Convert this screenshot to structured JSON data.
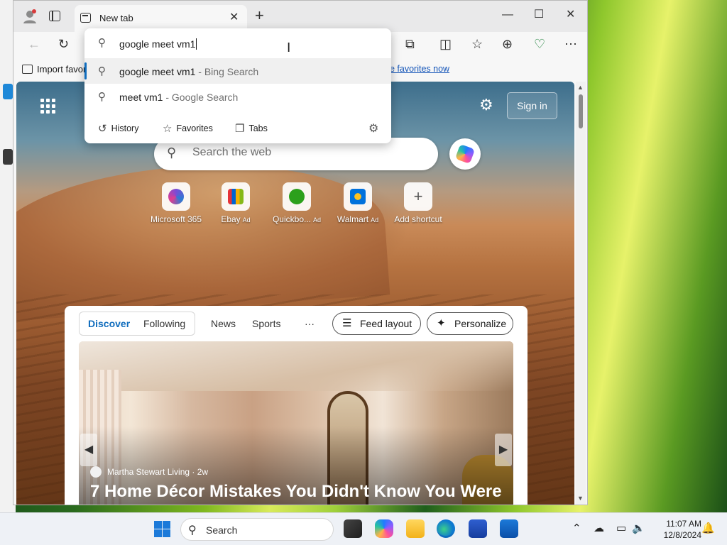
{
  "browser": {
    "tab_title": "New tab",
    "close_symbol": "✕",
    "new_tab_symbol": "+",
    "window_controls": {
      "minimize": "—",
      "maximize": "☐",
      "close": "✕"
    },
    "toolbar_icons": {
      "back": "←",
      "refresh": "↻",
      "extensions": "⧉",
      "split": "◫",
      "favorites": "☆",
      "collections": "⊕",
      "health": "♡",
      "more": "⋯"
    },
    "favorites_bar": {
      "import_label": "Import favor",
      "manage_link": "e favorites now"
    }
  },
  "omnibox": {
    "query": "google meet vm1",
    "suggestions": [
      {
        "text": "google meet vm1",
        "engine": " - Bing Search"
      },
      {
        "text": "meet vm1",
        "engine": " - Google Search"
      }
    ],
    "chips": [
      {
        "label": "History",
        "icon": "history-icon"
      },
      {
        "label": "Favorites",
        "icon": "star-icon"
      },
      {
        "label": "Tabs",
        "icon": "tabs-icon"
      }
    ]
  },
  "newtab": {
    "sign_in": "Sign in",
    "search_placeholder": "Search the web",
    "shortcuts": [
      {
        "label": "Microsoft 365",
        "ad": "",
        "color": "#7b4bd6"
      },
      {
        "label": "Ebay",
        "ad": "Ad",
        "color": "#e53238"
      },
      {
        "label": "Quickbo...",
        "ad": "Ad",
        "color": "#2ca01c"
      },
      {
        "label": "Walmart",
        "ad": "Ad",
        "color": "#0071dc"
      },
      {
        "label": "Add shortcut",
        "ad": "",
        "color": "#ffffff"
      }
    ],
    "feed": {
      "tabs": [
        "Discover",
        "Following",
        "News",
        "Sports",
        "···"
      ],
      "feed_layout": "Feed layout",
      "personalize": "Personalize",
      "article": {
        "source": "Martha Stewart Living",
        "age": " · 2w",
        "headline": "7 Home Décor Mistakes You Didn't Know You Were"
      }
    }
  },
  "taskbar": {
    "search_label": "Search",
    "time": "11:07 AM",
    "date": "12/8/2024"
  },
  "colors": {
    "accent": "#0f6cbd",
    "link": "#1455b8"
  }
}
